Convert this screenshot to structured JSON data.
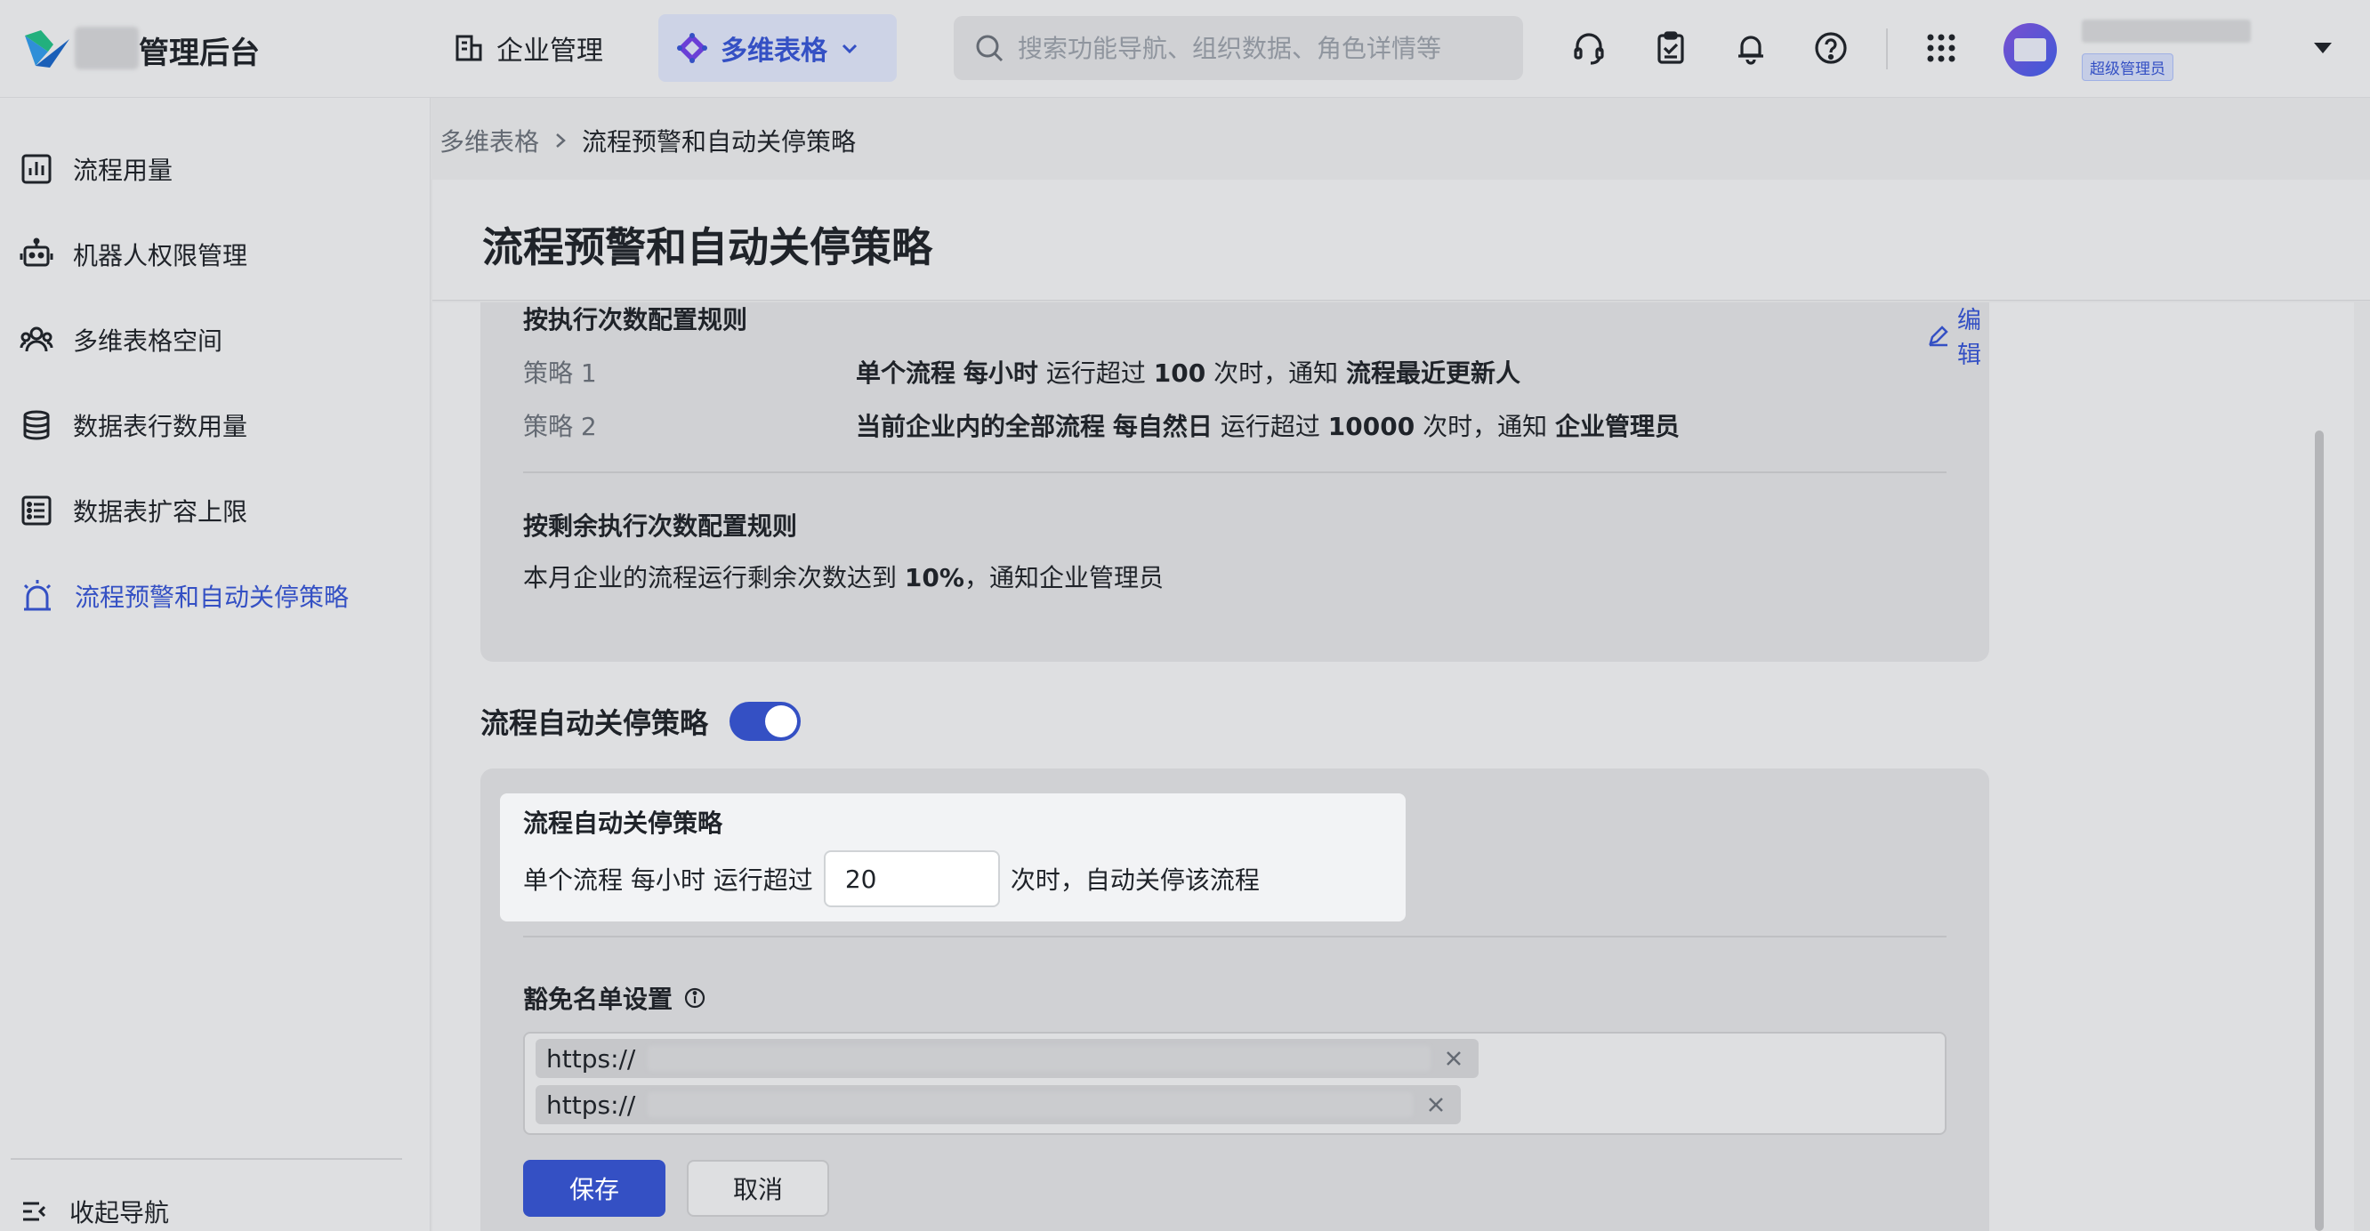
{
  "topbar": {
    "brand_suffix": "管理后台",
    "nav_enterprise": "企业管理",
    "nav_multidim": "多维表格",
    "search_placeholder": "搜索功能导航、组织数据、角色详情等",
    "role_badge": "超级管理员"
  },
  "sidebar": {
    "items": [
      {
        "label": "流程用量",
        "icon": "bar-chart-icon"
      },
      {
        "label": "机器人权限管理",
        "icon": "robot-icon"
      },
      {
        "label": "多维表格空间",
        "icon": "people-icon"
      },
      {
        "label": "数据表行数用量",
        "icon": "database-icon"
      },
      {
        "label": "数据表扩容上限",
        "icon": "list-icon"
      },
      {
        "label": "流程预警和自动关停策略",
        "icon": "alarm-icon",
        "active": true
      }
    ],
    "collapse_label": "收起导航"
  },
  "breadcrumb": {
    "parent": "多维表格",
    "current": "流程预警和自动关停策略"
  },
  "page_title": "流程预警和自动关停策略",
  "warning_rules": {
    "section1_title": "按执行次数配置规则",
    "edit_label": "编辑",
    "strategies": [
      {
        "label": "策略 1",
        "scope": "单个流程",
        "period": "每小时",
        "mid": "运行超过",
        "count": "100",
        "mid2": "次时，通知",
        "target": "流程最近更新人"
      },
      {
        "label": "策略 2",
        "scope": "当前企业内的全部流程",
        "period": "每自然日",
        "mid": "运行超过",
        "count": "10000",
        "mid2": "次时，通知",
        "target": "企业管理员"
      }
    ],
    "section2_title": "按剩余执行次数配置规则",
    "remaining_prefix": "本月企业的流程运行剩余次数达到",
    "remaining_value": "10%",
    "remaining_suffix": "，通知企业管理员"
  },
  "auto_stop": {
    "section_title": "流程自动关停策略",
    "toggle_on": true,
    "box_title": "流程自动关停策略",
    "row_prefix": "单个流程 每小时 运行超过",
    "threshold_value": "20",
    "row_suffix": "次时，自动关停该流程",
    "exempt_title": "豁免名单设置",
    "exempt_urls": [
      "https://",
      "https://"
    ],
    "save_label": "保存",
    "cancel_label": "取消"
  },
  "colors": {
    "accent": "#3450c4",
    "text": "#1f2329",
    "muted": "#646a73"
  }
}
